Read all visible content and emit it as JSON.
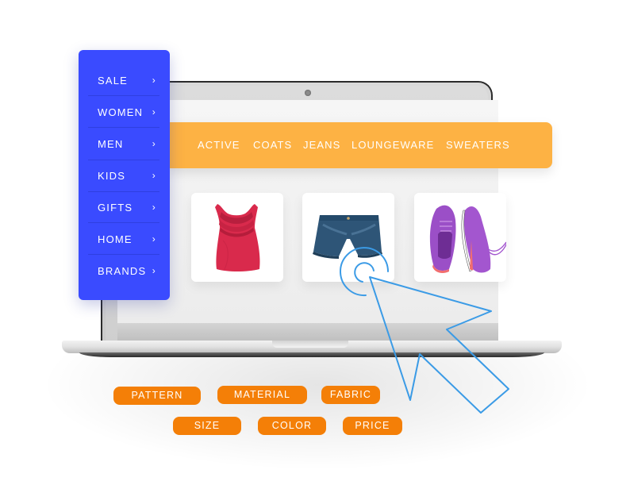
{
  "side_menu": {
    "items": [
      {
        "label": "SALE",
        "chevron": "›"
      },
      {
        "label": "WOMEN",
        "chevron": "›"
      },
      {
        "label": "MEN",
        "chevron": "›"
      },
      {
        "label": "KIDS",
        "chevron": "›"
      },
      {
        "label": "GIFTS",
        "chevron": "›"
      },
      {
        "label": "HOME",
        "chevron": "›"
      },
      {
        "label": "BRANDS",
        "chevron": "›"
      }
    ],
    "color": "#3a4bff"
  },
  "subcategory_bar": {
    "items": [
      "ACTIVE",
      "COATS",
      "JEANS",
      "LOUNGEWARE",
      "SWEATERS"
    ],
    "color": "#fdb244"
  },
  "products": [
    {
      "name": "red ruffle tank top",
      "icon": "tank-top-icon"
    },
    {
      "name": "denim shorts",
      "icon": "denim-shorts-icon"
    },
    {
      "name": "purple sneakers",
      "icon": "sneakers-icon"
    }
  ],
  "filters": {
    "row1": [
      "PATTERN",
      "MATERIAL",
      "FABRIC"
    ],
    "row2": [
      "SIZE",
      "COLOR",
      "PRICE"
    ],
    "color": "#f47f07"
  },
  "cursor": {
    "icon": "click-pointer-icon",
    "color": "#3b9be6"
  }
}
